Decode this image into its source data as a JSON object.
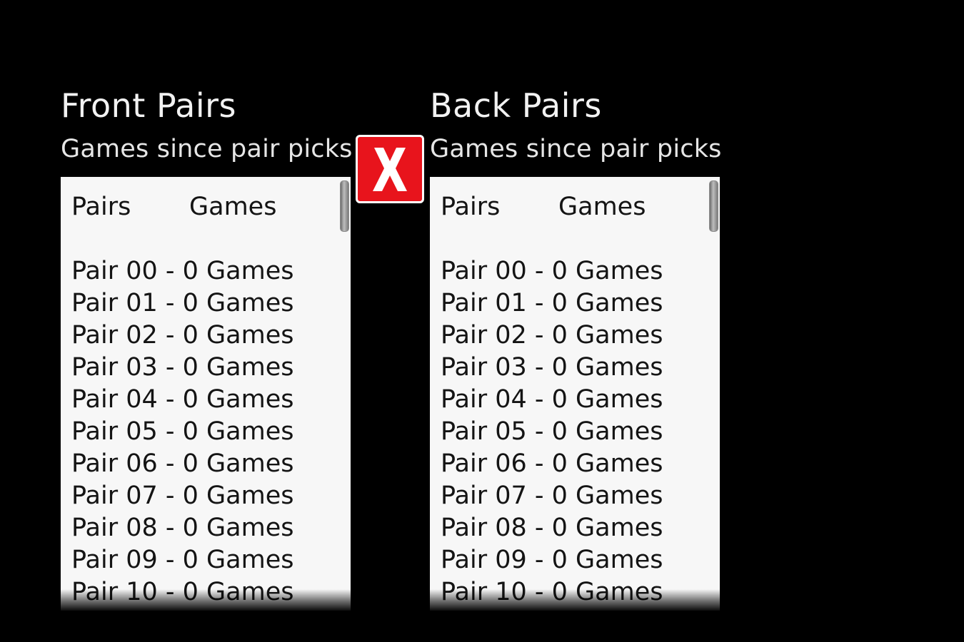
{
  "front": {
    "title": "Front Pairs",
    "subtitle": "Games since pair picks",
    "columns": [
      "Pairs",
      "Games"
    ],
    "rows": [
      "Pair 00 - 0 Games",
      "Pair 01 - 0 Games",
      "Pair 02 - 0 Games",
      "Pair 03 - 0 Games",
      "Pair 04 - 0 Games",
      "Pair 05 - 0 Games",
      "Pair 06 - 0 Games",
      "Pair 07 - 0 Games",
      "Pair 08 - 0 Games",
      "Pair 09 - 0 Games",
      "Pair 10 - 0 Games"
    ]
  },
  "back": {
    "title": "Back Pairs",
    "subtitle": "Games since pair picks",
    "columns": [
      "Pairs",
      "Games"
    ],
    "rows": [
      "Pair 00 - 0 Games",
      "Pair 01 - 0 Games",
      "Pair 02 - 0 Games",
      "Pair 03 - 0 Games",
      "Pair 04 - 0 Games",
      "Pair 05 - 0 Games",
      "Pair 06 - 0 Games",
      "Pair 07 - 0 Games",
      "Pair 08 - 0 Games",
      "Pair 09 - 0 Games",
      "Pair 10 - 0 Games"
    ]
  },
  "close_button": {
    "icon": "close-icon",
    "color": "#e8141c"
  }
}
